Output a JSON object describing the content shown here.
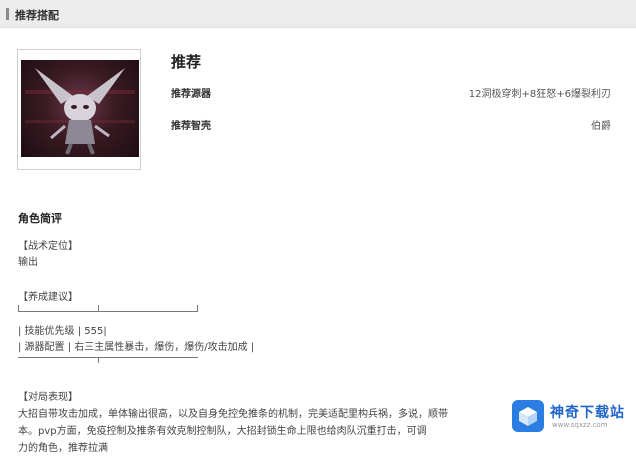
{
  "header": {
    "title": "推荐搭配"
  },
  "recommend": {
    "title": "推荐",
    "rows": [
      {
        "label": "推荐源器",
        "value": "12洞极穿刺+8狂怒+6爆裂利刃"
      },
      {
        "label": "推荐智壳",
        "value": "伯爵"
      }
    ]
  },
  "review": {
    "title": "角色简评",
    "positioning_heading": "【战术定位】",
    "positioning_value": "输出",
    "build_heading": "【养成建议】",
    "build_rows": [
      "| 技能优先级 | 555|",
      "| 源器配置 | 右三主属性暴击，爆伤，爆伤/攻击加成 |"
    ],
    "performance_heading": "【对局表现】",
    "performance_lines": [
      "大招自带攻击加成，单体输出很高，以及自身免控免推条的机制，完美适配里构兵祸，多说，顺带",
      "本。pvp方面，免疫控制及推条有效克制控制队，大招封锁生命上限也给肉队沉重打击，可调",
      "力的角色，推荐拉满"
    ]
  },
  "watermark": {
    "name": "神奇下载站",
    "url": "www.sqxzz.com"
  },
  "colors": {
    "header_bg": "#ececec",
    "watermark_blue": "#2a7de1"
  }
}
